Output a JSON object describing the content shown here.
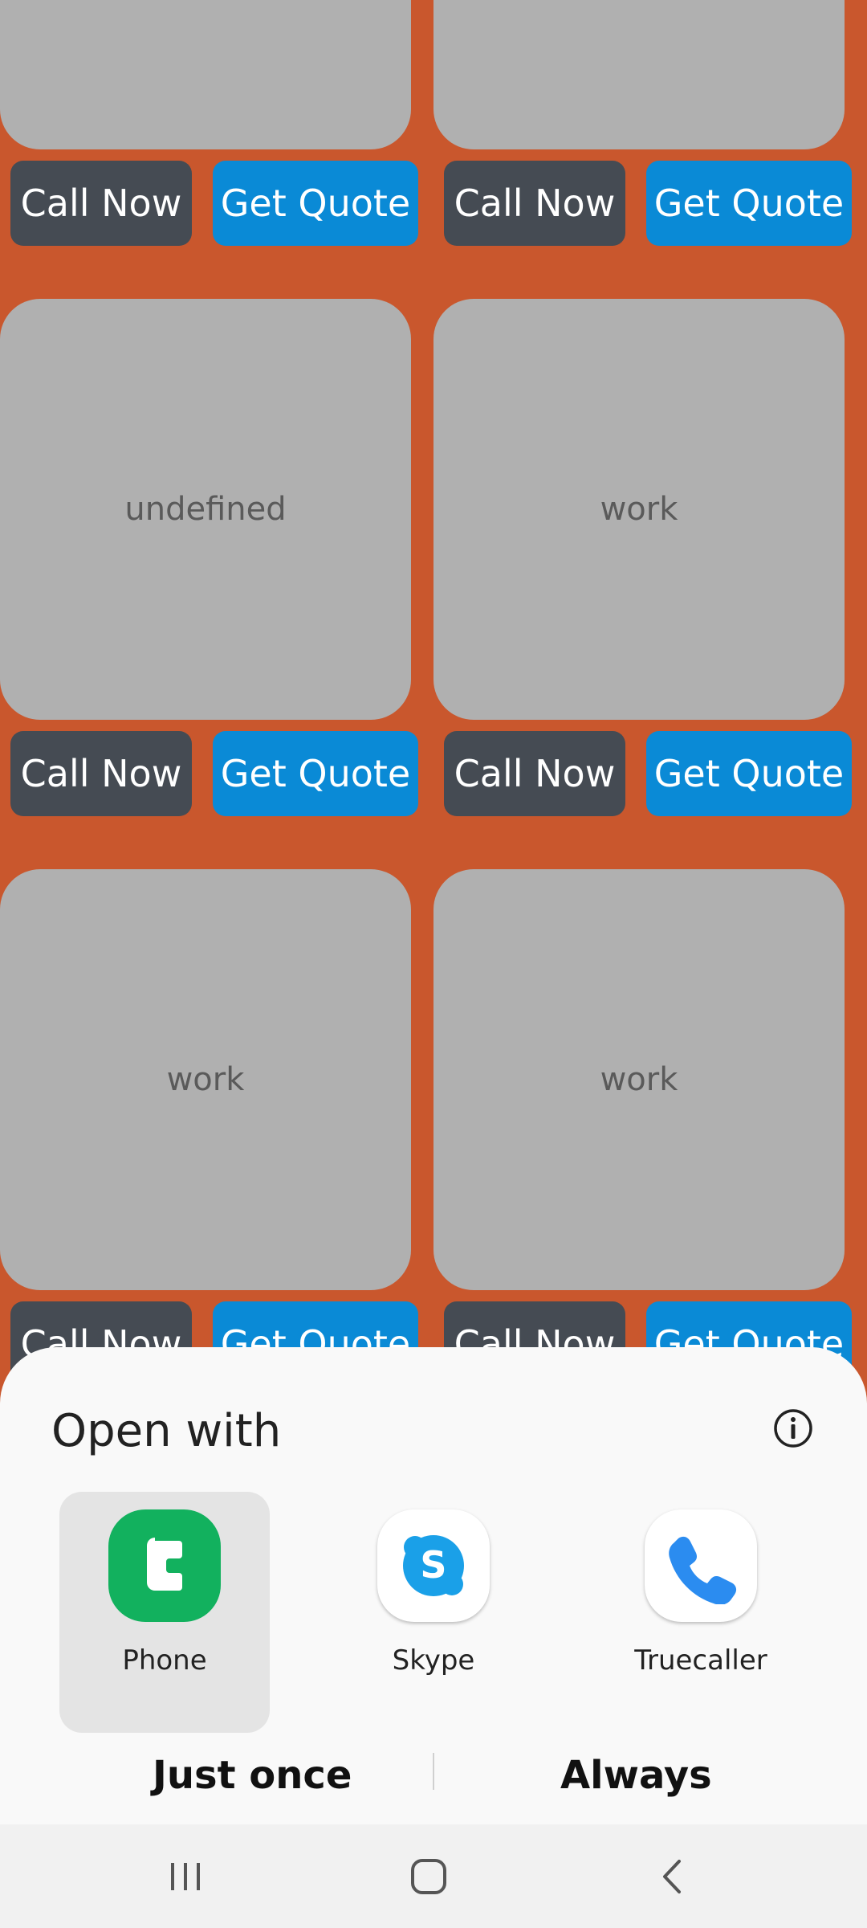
{
  "background": {
    "cards": [
      {
        "label": ""
      },
      {
        "label": ""
      },
      {
        "label": "undefined"
      },
      {
        "label": "work"
      },
      {
        "label": "work"
      },
      {
        "label": "work"
      }
    ],
    "buttons": {
      "call_label": "Call Now",
      "quote_label": "Get Quote"
    }
  },
  "sheet": {
    "title": "Open with",
    "apps": [
      {
        "name": "Phone",
        "icon": "phone-app-icon",
        "selected": true
      },
      {
        "name": "Skype",
        "icon": "skype-app-icon",
        "selected": false
      },
      {
        "name": "Truecaller",
        "icon": "truecaller-app-icon",
        "selected": false
      }
    ],
    "just_once_label": "Just once",
    "always_label": "Always"
  },
  "colors": {
    "background": "#c9572d",
    "call_button": "#454b53",
    "quote_button": "#0a8ad6",
    "phone_green": "#12b15e"
  }
}
